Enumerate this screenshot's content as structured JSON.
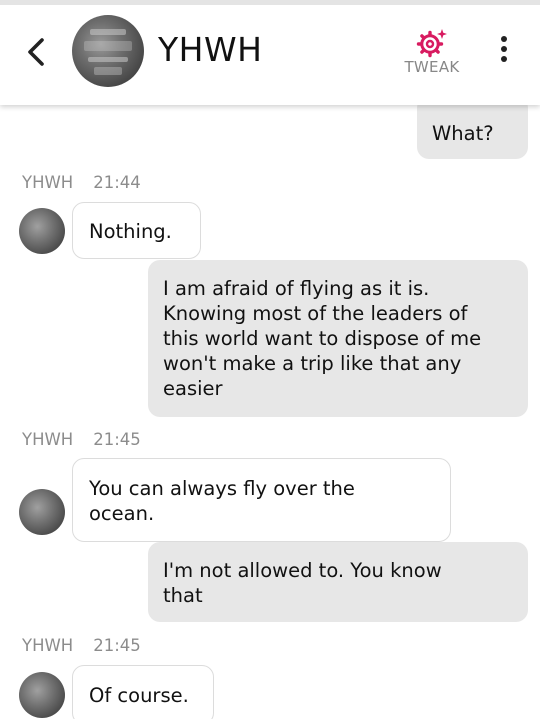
{
  "header": {
    "contact_name": "YHWH",
    "tweak_label": "TWEAK",
    "icons": {
      "back": "chevron-left-icon",
      "tweak": "gear-sparkle-icon",
      "menu": "more-vert-icon"
    },
    "accent_color": "#d81b60"
  },
  "messages": [
    {
      "direction": "outgoing",
      "text": "What?"
    },
    {
      "sender": "YHWH",
      "time": "21:44"
    },
    {
      "direction": "incoming",
      "text": "Nothing."
    },
    {
      "direction": "outgoing",
      "lines": [
        "I am afraid of flying as it is.",
        "Knowing most of the leaders of",
        "this world want to dispose of me",
        "won't make a trip like that any",
        "easier"
      ]
    },
    {
      "sender": "YHWH",
      "time": "21:45"
    },
    {
      "direction": "incoming",
      "lines": [
        "You can always fly over the",
        "ocean."
      ]
    },
    {
      "direction": "outgoing",
      "lines": [
        "I'm not allowed to. You know",
        "that"
      ]
    },
    {
      "sender": "YHWH",
      "time": "21:45"
    },
    {
      "direction": "incoming",
      "text": "Of course."
    }
  ]
}
